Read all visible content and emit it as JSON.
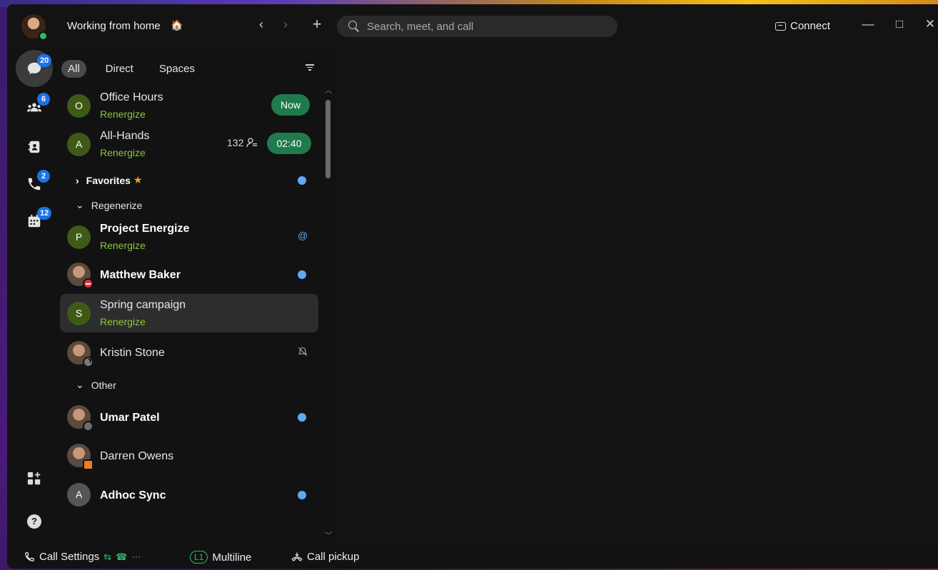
{
  "titlebar": {
    "status_text": "Working from home",
    "status_emoji": "🏠",
    "search_placeholder": "Search, meet, and call",
    "connect_label": "Connect",
    "nav_back": "‹",
    "nav_forward": "›",
    "nav_add": "+",
    "min": "—",
    "max": "□",
    "close": "✕"
  },
  "rail": {
    "items": [
      {
        "icon": "messaging-icon",
        "badge": "20",
        "active": true
      },
      {
        "icon": "teams-icon",
        "badge": "6"
      },
      {
        "icon": "contacts-icon",
        "badge": ""
      },
      {
        "icon": "calling-icon",
        "badge": "2"
      },
      {
        "icon": "calendar-icon",
        "badge": "12"
      }
    ]
  },
  "filters": {
    "all": "All",
    "direct": "Direct",
    "spaces": "Spaces"
  },
  "list": {
    "office_hours": {
      "initial": "O",
      "name": "Office Hours",
      "sub": "Renergize",
      "pill": "Now"
    },
    "all_hands": {
      "initial": "A",
      "name": "All-Hands",
      "sub": "Renergize",
      "count": "132",
      "pill": "02:40"
    },
    "favorites": {
      "label": "Favorites",
      "star": "★"
    },
    "regenerize": {
      "label": "Regenerize"
    },
    "project_energize": {
      "initial": "P",
      "name": "Project Energize",
      "sub": "Renergize",
      "mention": "@"
    },
    "matthew": {
      "name": "Matthew Baker"
    },
    "spring": {
      "initial": "S",
      "name": "Spring campaign",
      "sub": "Renergize"
    },
    "kristin": {
      "name": "Kristin Stone"
    },
    "other": {
      "label": "Other"
    },
    "umar": {
      "name": "Umar Patel"
    },
    "darren": {
      "name": "Darren Owens"
    },
    "adhoc": {
      "initial": "A",
      "name": "Adhoc Sync"
    }
  },
  "bottombar": {
    "call_settings": "Call Settings",
    "line": "L1",
    "multiline": "Multiline",
    "call_pickup": "Call pickup"
  },
  "colors": {
    "accent_green": "#1f7a4d",
    "badge_blue": "#1a73e8",
    "unread_dot": "#5ea9f6",
    "space_sub": "#8cc63f"
  }
}
